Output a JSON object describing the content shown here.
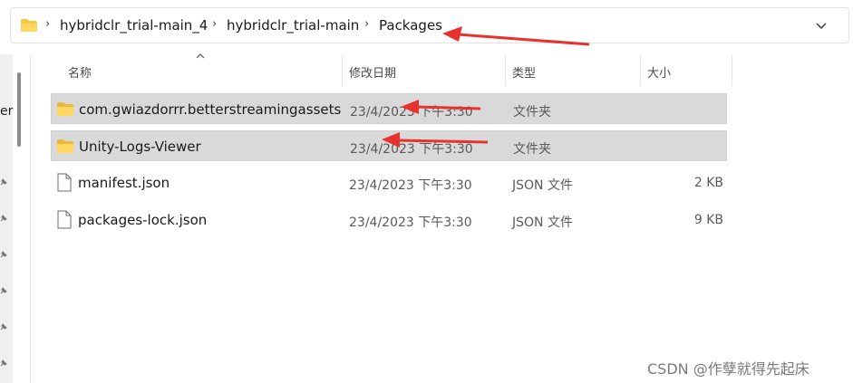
{
  "address_bar": {
    "crumbs": [
      "hybridclr_trial-main_4",
      "hybridclr_trial-main",
      "Packages"
    ]
  },
  "left_nav": {
    "partial_label": "er"
  },
  "columns": {
    "name": "名称",
    "date": "修改日期",
    "type": "类型",
    "size": "大小"
  },
  "files": [
    {
      "name": "com.gwiazdorrr.betterstreamingassets",
      "date": "23/4/2023 下午3:30",
      "type": "文件夹",
      "size": "",
      "icon": "folder-icon",
      "selected": true
    },
    {
      "name": "Unity-Logs-Viewer",
      "date": "23/4/2023 下午3:30",
      "type": "文件夹",
      "size": "",
      "icon": "folder-icon",
      "selected": true
    },
    {
      "name": "manifest.json",
      "date": "23/4/2023 下午3:30",
      "type": "JSON 文件",
      "size": "2 KB",
      "icon": "file-icon",
      "selected": false
    },
    {
      "name": "packages-lock.json",
      "date": "23/4/2023 下午3:30",
      "type": "JSON 文件",
      "size": "9 KB",
      "icon": "file-icon",
      "selected": false
    }
  ],
  "colors": {
    "folder": "#f6c945",
    "selection": "#d9d9d9",
    "annotation": "#e8322e"
  },
  "watermark": "CSDN @作孽就得先起床"
}
